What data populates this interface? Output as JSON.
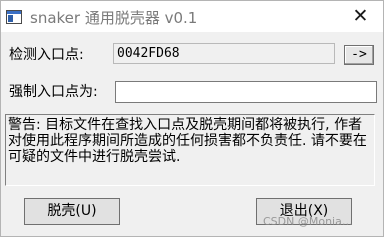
{
  "window": {
    "title": "snaker 通用脱壳器 v0.1",
    "close_label": "✕"
  },
  "detect": {
    "label": "检测入口点:",
    "value": "0042FD68",
    "go_button": "->"
  },
  "force": {
    "label": "强制入口点为:",
    "value": ""
  },
  "warning": {
    "text": "警告: 目标文件在查找入口点及脱壳期间都将被执行, 作者对使用此程序期间所造成的任何损害都不负责任. 请不要在可疑的文件中进行脱壳尝试."
  },
  "buttons": {
    "unpack": "脱壳(U)",
    "exit": "退出(X)"
  },
  "watermark": "CSDN @Monia…",
  "colors": {
    "window_bg": "#f0f0f0",
    "titlebar_bg": "#ffffff"
  }
}
